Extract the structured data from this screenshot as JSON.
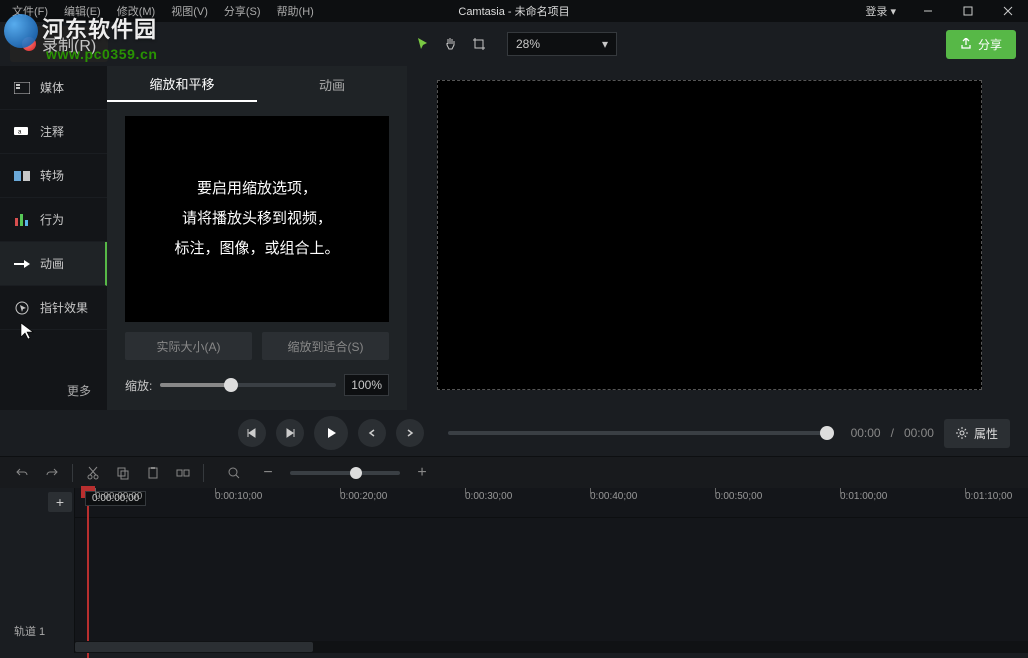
{
  "menu": {
    "file": "文件(F)",
    "edit": "编辑(E)",
    "modify": "修改(M)",
    "view": "视图(V)",
    "share": "分享(S)",
    "help": "帮助(H)"
  },
  "window_title": "Camtasia - 未命名项目",
  "login": "登录 ▾",
  "record": "录制(R)",
  "canvas_zoom": "28%",
  "share_button": "分享",
  "sidebar": {
    "items": [
      "媒体",
      "注释",
      "转场",
      "行为",
      "动画",
      "指针效果"
    ],
    "more": "更多"
  },
  "panel": {
    "tabs": [
      "缩放和平移",
      "动画"
    ],
    "hint": {
      "l1": "要启用缩放选项，",
      "l2": "请将播放头移到视频，",
      "l3": "标注，图像，或组合上。"
    },
    "actual_size": "实际大小(A)",
    "fit": "缩放到适合(S)",
    "zoom_label": "缩放:",
    "zoom_value": "100%"
  },
  "playback": {
    "current": "00:00",
    "sep": "/",
    "total": "00:00"
  },
  "properties": "属性",
  "timeline": {
    "playhead_time": "0:00:00;00",
    "track_name": "轨道 1",
    "ticks": [
      "0:00:00;00",
      "0:00:10;00",
      "0:00:20;00",
      "0:00:30;00",
      "0:00:40;00",
      "0:00:50;00",
      "0:01:00;00",
      "0:01:10;00"
    ]
  },
  "watermark": {
    "brand": "河东软件园",
    "url": "www.pc0359.cn"
  }
}
